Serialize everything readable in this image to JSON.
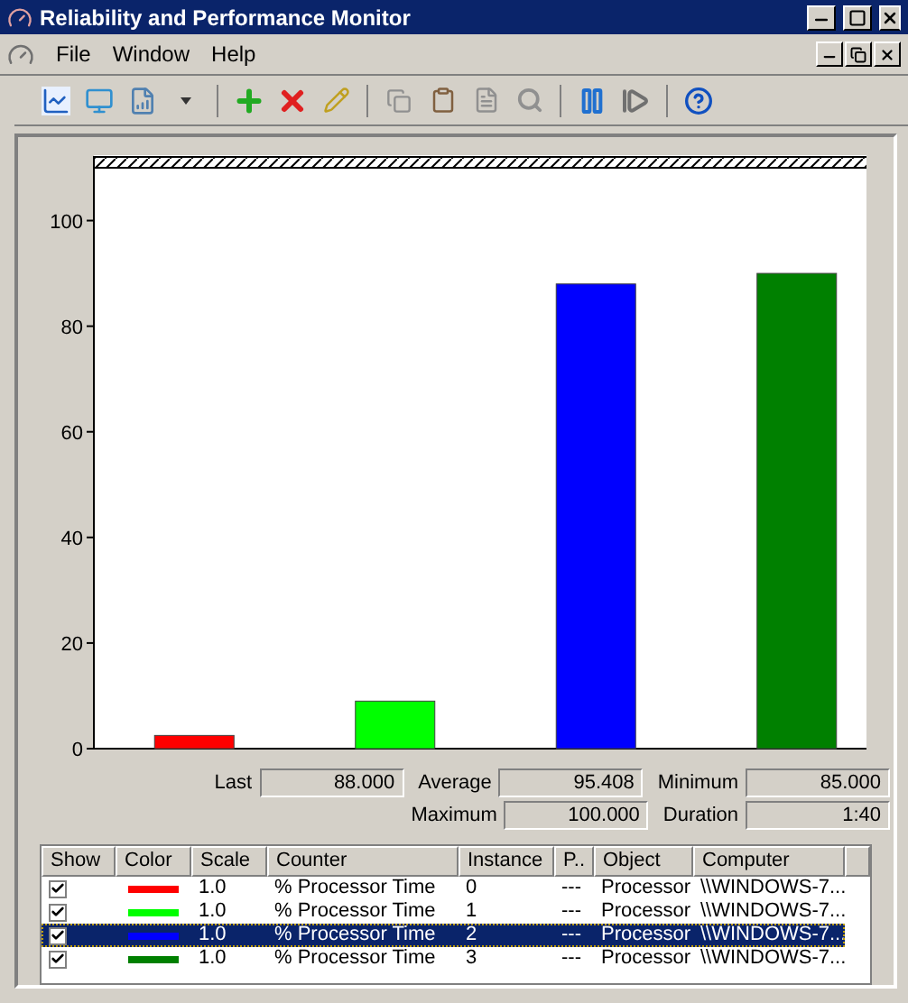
{
  "window": {
    "title": "Reliability and Performance Monitor"
  },
  "menu": [
    {
      "label": "File"
    },
    {
      "label": "Window"
    },
    {
      "label": "Help"
    }
  ],
  "chart": {
    "chart_data": {
      "type": "bar",
      "values": [
        2.5,
        9,
        88,
        90
      ],
      "ylim": [
        0,
        110
      ],
      "yticks": [
        0,
        20,
        40,
        60,
        80,
        100
      ]
    }
  },
  "stats": {
    "last": {
      "label": "Last",
      "value": "88.000"
    },
    "average": {
      "label": "Average",
      "value": "95.408"
    },
    "minimum": {
      "label": "Minimum",
      "value": "85.000"
    },
    "maximum": {
      "label": "Maximum",
      "value": "100.000"
    },
    "duration": {
      "label": "Duration",
      "value": "1:40"
    }
  },
  "table": {
    "columns": [
      "Show",
      "Color",
      "Scale",
      "Counter",
      "Instance",
      "P..",
      "Object",
      "Computer"
    ],
    "rows": [
      {
        "show": true,
        "color": "#ff0000",
        "scale": "1.0",
        "counter": "% Processor Time",
        "instance": "0",
        "parent": "---",
        "object": "Processor",
        "computer": "\\\\WINDOWS-7...",
        "selected": false
      },
      {
        "show": true,
        "color": "#00ff00",
        "scale": "1.0",
        "counter": "% Processor Time",
        "instance": "1",
        "parent": "---",
        "object": "Processor",
        "computer": "\\\\WINDOWS-7...",
        "selected": false
      },
      {
        "show": true,
        "color": "#0000ff",
        "scale": "1.0",
        "counter": "% Processor Time",
        "instance": "2",
        "parent": "---",
        "object": "Processor",
        "computer": "\\\\WINDOWS-7...",
        "selected": true
      },
      {
        "show": true,
        "color": "#008000",
        "scale": "1.0",
        "counter": "% Processor Time",
        "instance": "3",
        "parent": "---",
        "object": "Processor",
        "computer": "\\\\WINDOWS-7...",
        "selected": false
      }
    ]
  }
}
